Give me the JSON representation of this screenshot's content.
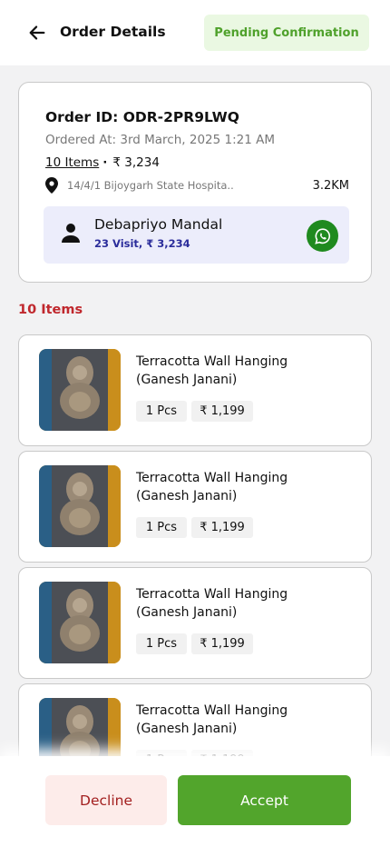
{
  "header": {
    "title": "Order Details",
    "status": "Pending Confirmation",
    "back_icon": "arrow-left-icon"
  },
  "order": {
    "id_text": "Order ID: ODR-2PR9LWQ",
    "ordered_at": "Ordered At: 3rd March, 2025 1:21 AM",
    "items_count_link": "10 Items",
    "total": "₹ 3,234",
    "address": "14/4/1 Bijoygarh State Hospita..",
    "distance": "3.2KM"
  },
  "customer": {
    "name": "Debapriyo Mandal",
    "meta": "23 Visit, ₹ 3,234",
    "action_icon": "whatsapp-icon"
  },
  "items_heading": "10 Items",
  "items": [
    {
      "name": "Terracotta Wall Hanging (Ganesh Janani)",
      "qty": "1 Pcs",
      "price": "₹ 1,199"
    },
    {
      "name": "Terracotta Wall Hanging (Ganesh Janani)",
      "qty": "1 Pcs",
      "price": "₹ 1,199"
    },
    {
      "name": "Terracotta Wall Hanging (Ganesh Janani)",
      "qty": "1 Pcs",
      "price": "₹ 1,199"
    },
    {
      "name": "Terracotta Wall Hanging (Ganesh Janani)",
      "qty": "1 Pcs",
      "price": "₹ 1,199"
    }
  ],
  "actions": {
    "decline": "Decline",
    "accept": "Accept"
  },
  "colors": {
    "accent_green": "#52a52c",
    "status_green": "#4fa12b",
    "items_red": "#c0282d",
    "customer_blue": "#2b2d9b"
  }
}
